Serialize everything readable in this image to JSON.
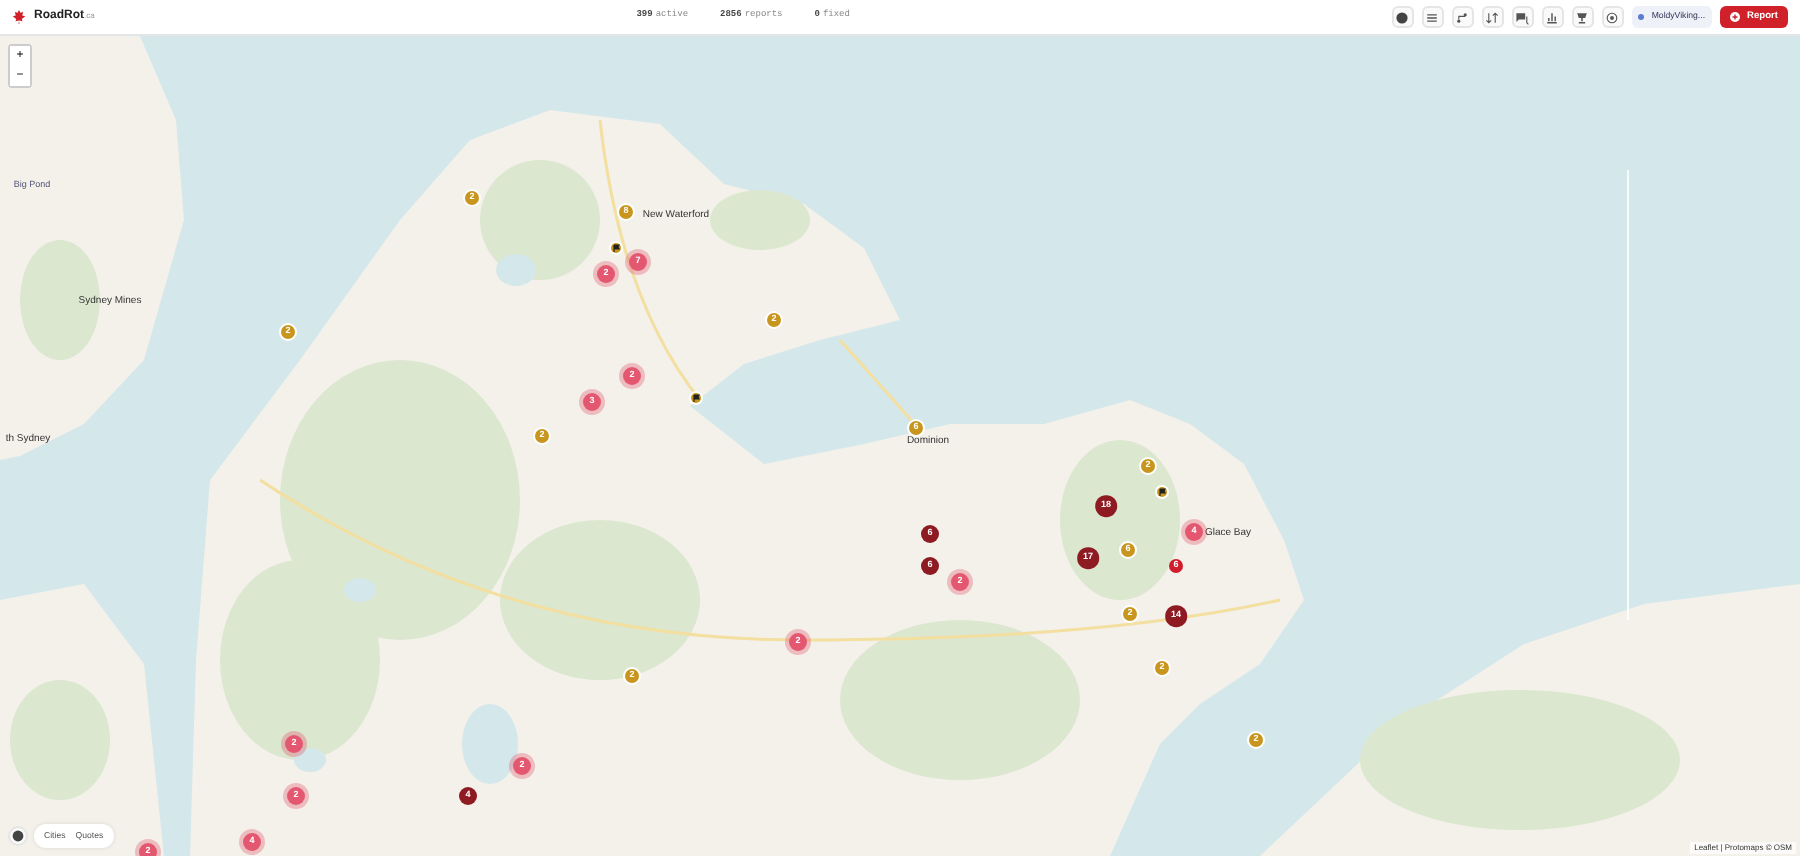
{
  "header": {
    "logo": "RoadRot",
    "logo_suffix": ".ca",
    "stats": [
      {
        "value": "399",
        "label": "active"
      },
      {
        "value": "2856",
        "label": "reports"
      },
      {
        "value": "0",
        "label": "fixed"
      }
    ],
    "user": "MoldyViking...",
    "report_button": "Report"
  },
  "map": {
    "zoom_in": "+",
    "zoom_out": "−",
    "places": [
      "Big Pond",
      "Sydney Mines",
      "th Sydney",
      "New Waterford",
      "Dominion",
      "Glace Bay"
    ],
    "markers": [
      {
        "kind": "cluster",
        "count": "2"
      },
      {
        "kind": "cluster",
        "count": "7"
      },
      {
        "kind": "cluster",
        "count": "2"
      },
      {
        "kind": "cluster",
        "count": "3"
      },
      {
        "kind": "cluster",
        "count": "2"
      },
      {
        "kind": "cluster",
        "count": "2"
      },
      {
        "kind": "cluster",
        "count": "2"
      },
      {
        "kind": "cluster",
        "count": "2"
      },
      {
        "kind": "cluster",
        "count": "2"
      },
      {
        "kind": "cluster",
        "count": "4"
      },
      {
        "kind": "cluster",
        "count": "2"
      },
      {
        "kind": "cluster",
        "count": "4"
      },
      {
        "kind": "severe",
        "count": "18"
      },
      {
        "kind": "severe",
        "count": "6"
      },
      {
        "kind": "severe",
        "count": "6"
      },
      {
        "kind": "severe",
        "count": "17"
      },
      {
        "kind": "severe",
        "count": "14"
      },
      {
        "kind": "severe",
        "count": "4"
      },
      {
        "kind": "severe",
        "count": "6"
      },
      {
        "kind": "minor",
        "count": "8"
      },
      {
        "kind": "minor",
        "count": "2"
      },
      {
        "kind": "minor",
        "count": "2"
      },
      {
        "kind": "minor",
        "count": "2"
      },
      {
        "kind": "minor",
        "count": "2"
      },
      {
        "kind": "minor",
        "count": "6"
      },
      {
        "kind": "minor",
        "count": "2"
      },
      {
        "kind": "minor",
        "count": "6"
      },
      {
        "kind": "minor",
        "count": "2"
      },
      {
        "kind": "minor",
        "count": "2"
      },
      {
        "kind": "minor",
        "count": "2"
      },
      {
        "kind": "minor",
        "count": "2"
      },
      {
        "kind": "flagged"
      },
      {
        "kind": "flagged"
      },
      {
        "kind": "flagged"
      }
    ],
    "layer_toggles": [
      {
        "label": "Cities",
        "selected": false
      },
      {
        "label": "Quotes",
        "selected": false
      }
    ],
    "attribution": "Leaflet | Protomaps © OSM"
  }
}
